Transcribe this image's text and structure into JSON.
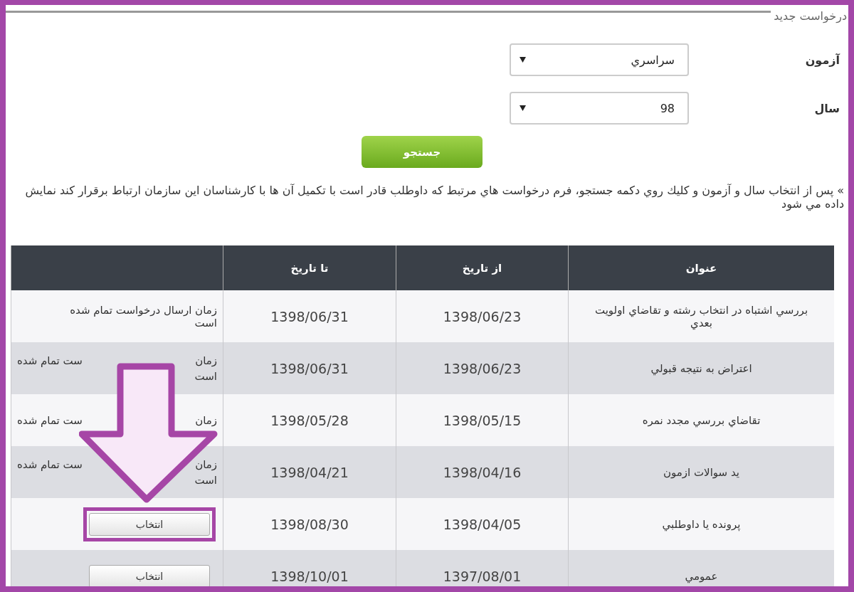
{
  "legend": "درخواست جديد",
  "fields": [
    {
      "label": "آزمون",
      "value": "سراسري"
    },
    {
      "label": "سال",
      "value": "98"
    }
  ],
  "search_button": "جستجو",
  "note": "» پس از انتخاب سال و آزمون و كليك روي دكمه جستجو، فرم درخواست هاي مرتبط كه داوطلب قادر است با تكميل آن ها با كارشناسان اين سازمان ارتباط برقرار كند نمايش داده مي شود",
  "table": {
    "columns": [
      "عنوان",
      "از تاريخ",
      "تا تاريخ"
    ],
    "rows": [
      {
        "title": "بررسي اشتباه در انتخاب رشته و تقاضاي اولويت بعدي",
        "from": "1398/06/23",
        "to": "1398/06/31",
        "action": {
          "kind": "text",
          "text": "زمان ارسال درخواست تمام شده است"
        }
      },
      {
        "title": "اعتراض به نتيجه قبولي",
        "from": "1398/06/23",
        "to": "1398/06/31",
        "action": {
          "kind": "covered",
          "right": "زمان",
          "left": "ست تمام شده",
          "second": "است"
        }
      },
      {
        "title": "تقاضاي بررسي مجدد نمره",
        "from": "1398/05/15",
        "to": "1398/05/28",
        "action": {
          "kind": "covered",
          "right": "زمان",
          "left": "ست تمام شده"
        }
      },
      {
        "title": "يد سوالات ازمون",
        "from": "1398/04/16",
        "to": "1398/04/21",
        "action": {
          "kind": "covered",
          "right": "زمان",
          "left": "ست تمام شده",
          "second": "است"
        }
      },
      {
        "title": "پرونده يا داوطلبي",
        "from": "1398/04/05",
        "to": "1398/08/30",
        "action": {
          "kind": "button",
          "label": "انتخاب",
          "highlighted": true
        }
      },
      {
        "title": "عمومي",
        "from": "1397/08/01",
        "to": "1398/10/01",
        "action": {
          "kind": "button",
          "label": "انتخاب",
          "highlighted": false
        }
      }
    ]
  }
}
